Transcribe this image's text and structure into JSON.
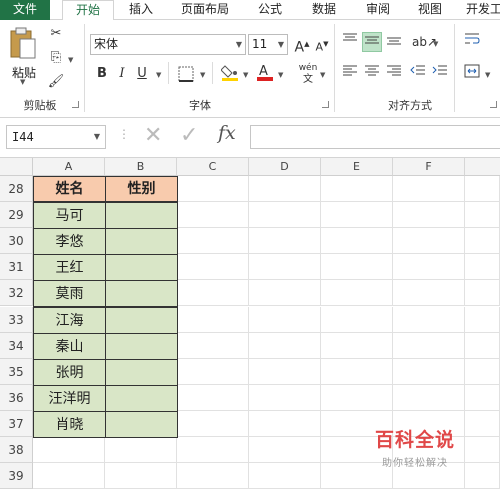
{
  "ribbon_tabs": [
    "文件",
    "开始",
    "插入",
    "页面布局",
    "公式",
    "数据",
    "审阅",
    "视图",
    "开发工"
  ],
  "ribbon": {
    "paste_label": "粘贴",
    "clipboard_group": "剪贴板",
    "font_group": "字体",
    "align_group": "对齐方式",
    "font_name": "宋体",
    "font_size": "11",
    "bold": "B",
    "italic": "I",
    "underline": "U",
    "font_color_letter": "A",
    "phonetic": "wén"
  },
  "formula_bar": {
    "name_box": "I44",
    "fx": "fx",
    "value": ""
  },
  "columns": [
    "A",
    "B",
    "C",
    "D",
    "E",
    "F"
  ],
  "rows": [
    "28",
    "29",
    "30",
    "31",
    "32",
    "33",
    "34",
    "35",
    "36",
    "37",
    "38",
    "39"
  ],
  "table": {
    "headers": [
      "姓名",
      "性别"
    ],
    "names": [
      "马可",
      "李悠",
      "王红",
      "莫雨",
      "江海",
      "秦山",
      "张明",
      "汪洋明",
      "肖晓"
    ],
    "gender": [
      "",
      "",
      "",
      "",
      "",
      "",
      "",
      "",
      ""
    ]
  },
  "watermark": {
    "title": "百科全说",
    "subtitle": "助你轻松解决"
  },
  "colors": {
    "accent": "#217346",
    "header_fill": "#f8cbad",
    "body_fill": "#d9e6c7",
    "selected_align": "#bfe3c9"
  },
  "icons": [
    "cut-icon",
    "copy-icon",
    "format-painter-icon",
    "grow-font-icon",
    "shrink-font-icon",
    "border-icon",
    "fill-color-icon",
    "font-color-icon",
    "align-top-icon",
    "align-middle-icon",
    "align-bottom-icon",
    "orientation-icon",
    "wrap-text-icon",
    "align-left-icon",
    "align-center-icon",
    "align-right-icon",
    "decrease-indent-icon",
    "increase-indent-icon",
    "merge-center-icon",
    "cancel-icon",
    "enter-icon",
    "function-icon"
  ]
}
